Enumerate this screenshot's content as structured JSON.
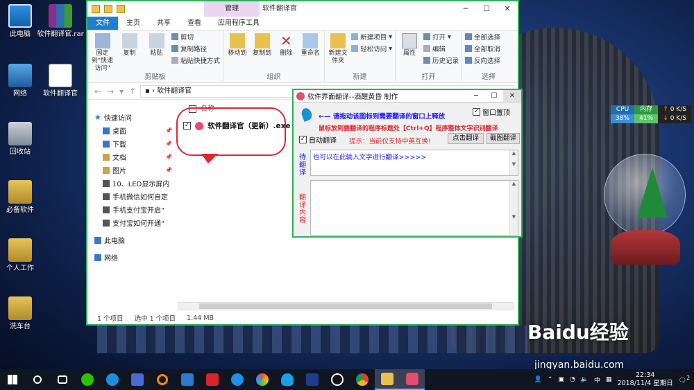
{
  "desktop": {
    "icons": [
      {
        "label": "此电脑",
        "name": "this-pc"
      },
      {
        "label": "软件翻译官.rar",
        "name": "rar-archive"
      },
      {
        "label": "网络",
        "name": "network"
      },
      {
        "label": "软件翻译官",
        "name": "translator-file"
      },
      {
        "label": "回收站",
        "name": "recycle-bin"
      },
      {
        "label": "必备软件",
        "name": "essentials-folder"
      },
      {
        "label": "个人工作",
        "name": "personal-folder"
      },
      {
        "label": "洗车台",
        "name": "carwash-folder"
      }
    ]
  },
  "explorer": {
    "context_tab": "管理",
    "title": "软件翻译官",
    "tabs": [
      "文件",
      "主页",
      "共享",
      "查看",
      "应用程序工具"
    ],
    "ribbon": {
      "clipboard": {
        "name": "剪贴板",
        "pin": "固定到\"快速访问\"",
        "copy": "复制",
        "paste": "粘贴",
        "cut": "剪切",
        "copy_path": "复制路径",
        "paste_shortcut": "粘贴快捷方式"
      },
      "organize": {
        "name": "组织",
        "move_to": "移动到",
        "copy_to": "复制到",
        "delete": "删除",
        "rename": "重命名"
      },
      "new": {
        "name": "新建",
        "new_folder": "新建文件夹",
        "new_item": "新建项目",
        "easy_access": "轻松访问"
      },
      "open": {
        "name": "打开",
        "properties": "属性",
        "open": "打开",
        "edit": "编辑",
        "history": "历史记录"
      },
      "select": {
        "name": "选择",
        "select_all": "全部选择",
        "select_none": "全部取消",
        "invert": "反向选择"
      }
    },
    "address": "软件翻译官",
    "nav": {
      "quick_access": "快速访问",
      "items": [
        {
          "label": "桌面",
          "pinned": true
        },
        {
          "label": "下载",
          "pinned": true
        },
        {
          "label": "文档",
          "pinned": true
        },
        {
          "label": "图片",
          "pinned": true
        },
        {
          "label": "10、LED显示屏内"
        },
        {
          "label": "手机微信如何自定"
        },
        {
          "label": "手机支付宝开启“"
        },
        {
          "label": "支付宝如何开通“"
        }
      ],
      "this_pc": "此电脑",
      "network": "网络"
    },
    "column_name": "名称",
    "file": {
      "name": "软件翻译官（更新）.exe",
      "checked": true
    },
    "status": {
      "count": "1 个项目",
      "selected": "选中 1 个项目",
      "size": "1.44 MB"
    }
  },
  "translator": {
    "title": "软件界面翻译--酒醒黄昏 制作",
    "hint_drag": "←— 请拖动该图标到需要翻译的窗口上释放",
    "hint_ctrl": "鼠标放到要翻译的程序标题处【Ctrl+Q】程序整体文字识别翻译",
    "hint_lang": "提示：当前仅支持中英互换!",
    "always_on_top": "窗口置顶",
    "auto_translate": "自动翻译",
    "btn_click": "点击翻译",
    "btn_screenshot": "截图翻译",
    "label_source": "待翻译",
    "label_result": "翻译内容",
    "source_placeholder": "也可以在此输入文字进行翻译>>>>>"
  },
  "widgets": {
    "perf": {
      "cpu_label": "CPU",
      "mem_label": "内存",
      "net_up": "0 K/S",
      "cpu": "38%",
      "mem": "41%",
      "net_down": "0 K/S"
    },
    "clock_desk": "22:34"
  },
  "watermark": {
    "text": "Baidu经验",
    "url": "jingyan.baidu.com"
  },
  "taskbar": {
    "time": "22:34",
    "date": "2018/11/4 星期日",
    "ime": "中",
    "notif_count": "2"
  },
  "colors": {
    "accent": "#2fb05a",
    "file_tab": "#1e7fd0",
    "annotation": "#e3262e",
    "hint_blue": "#1a1aff"
  }
}
